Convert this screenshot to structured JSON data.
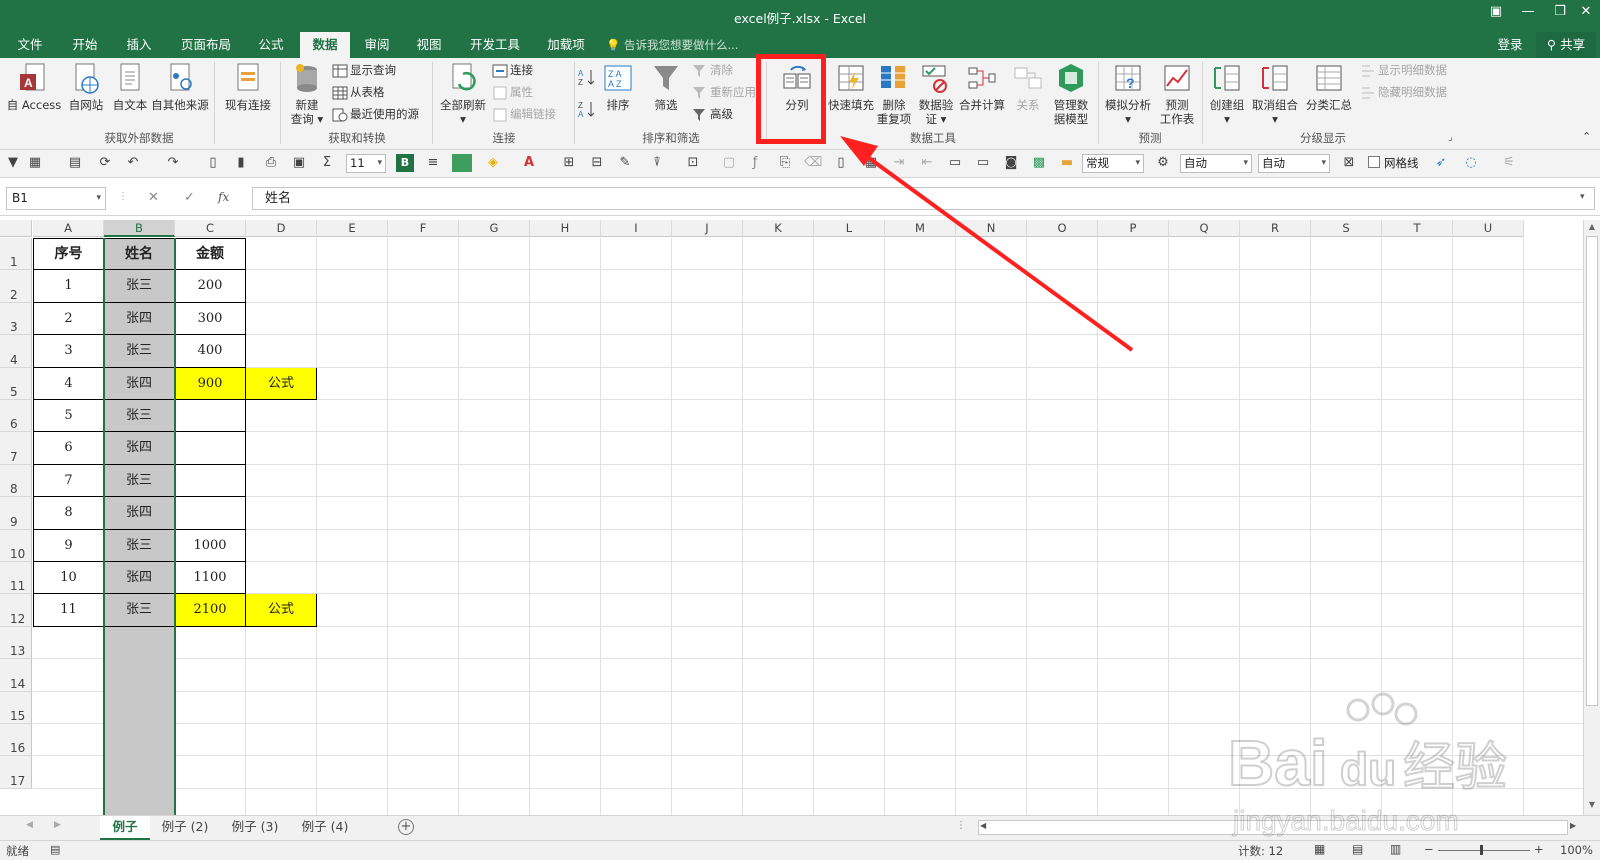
{
  "window": {
    "title": "excel例子.xlsx - Excel"
  },
  "tabs": [
    {
      "label": "文件"
    },
    {
      "label": "开始"
    },
    {
      "label": "插入"
    },
    {
      "label": "页面布局"
    },
    {
      "label": "公式"
    },
    {
      "label": "数据"
    },
    {
      "label": "审阅"
    },
    {
      "label": "视图"
    },
    {
      "label": "开发工具"
    },
    {
      "label": "加载项"
    }
  ],
  "tell_me": "告诉我您想要做什么...",
  "account": {
    "login": "登录",
    "share": "共享"
  },
  "ribbon": {
    "g1": {
      "access": "自 Access",
      "web": "自网站",
      "text": "自文本",
      "other": "自其他来源",
      "existing": "现有连接",
      "name": "获取外部数据"
    },
    "g2": {
      "new_query_1": "新建",
      "new_query_2": "查询",
      "show_query": "显示查询",
      "from_table": "从表格",
      "recent": "最近使用的源",
      "name": "获取和转换"
    },
    "g3": {
      "refresh": "全部刷新",
      "connections": "连接",
      "properties": "属性",
      "edit_links": "编辑链接",
      "name": "连接"
    },
    "g4": {
      "sort": "排序",
      "filter": "筛选",
      "clear": "清除",
      "reapply": "重新应用",
      "advanced": "高级",
      "name": "排序和筛选"
    },
    "g5": {
      "split": "分列",
      "flash_fill": "快速填充",
      "remove_dup_1": "删除",
      "remove_dup_2": "重复项",
      "validate_1": "数据验",
      "validate_2": "证",
      "consolidate": "合并计算",
      "relations": "关系",
      "model_1": "管理数",
      "model_2": "据模型",
      "name": "数据工具"
    },
    "g6": {
      "whatif": "模拟分析",
      "forecast_1": "预测",
      "forecast_2": "工作表",
      "name": "预测"
    },
    "g7": {
      "group": "创建组",
      "ungroup": "取消组合",
      "subtotal": "分类汇总",
      "show_detail": "显示明细数据",
      "hide_detail": "隐藏明细数据",
      "name": "分级显示"
    }
  },
  "qat": {
    "font_size": "11",
    "bold": "B",
    "number_format": "常规",
    "auto1": "自动",
    "auto2": "自动",
    "gridlines": "网格线"
  },
  "formula_bar": {
    "cell_ref": "B1",
    "fx": "fx",
    "value": "姓名"
  },
  "columns": [
    "A",
    "B",
    "C",
    "D",
    "E",
    "F",
    "G",
    "H",
    "I",
    "J",
    "K",
    "L",
    "M",
    "N",
    "O",
    "P",
    "Q",
    "R",
    "S",
    "T",
    "U"
  ],
  "rows": [
    "1",
    "2",
    "3",
    "4",
    "5",
    "6",
    "7",
    "8",
    "9",
    "10",
    "11",
    "12",
    "13",
    "14",
    "15",
    "16",
    "17"
  ],
  "table": {
    "headers": [
      "序号",
      "姓名",
      "金额"
    ],
    "rows": [
      [
        "1",
        "张三",
        "200",
        ""
      ],
      [
        "2",
        "张四",
        "300",
        ""
      ],
      [
        "3",
        "张三",
        "400",
        ""
      ],
      [
        "4",
        "张四",
        "900",
        "公式"
      ],
      [
        "5",
        "张三",
        "",
        ""
      ],
      [
        "6",
        "张四",
        "",
        ""
      ],
      [
        "7",
        "张三",
        "",
        ""
      ],
      [
        "8",
        "张四",
        "",
        ""
      ],
      [
        "9",
        "张三",
        "1000",
        ""
      ],
      [
        "10",
        "张四",
        "1100",
        ""
      ],
      [
        "11",
        "张三",
        "2100",
        "公式"
      ]
    ]
  },
  "sheets": [
    "例子",
    "例子 (2)",
    "例子 (3)",
    "例子 (4)"
  ],
  "status": {
    "ready": "就绪",
    "count": "计数: 12",
    "zoom": "100%"
  },
  "watermark": {
    "brand": "Bai",
    "brand2": "du",
    "cn": "经验",
    "url": "jingyan.baidu.com"
  },
  "colors": {
    "excel_green": "#217346",
    "highlight": "#ffff00",
    "annotation": "#ff2020"
  }
}
